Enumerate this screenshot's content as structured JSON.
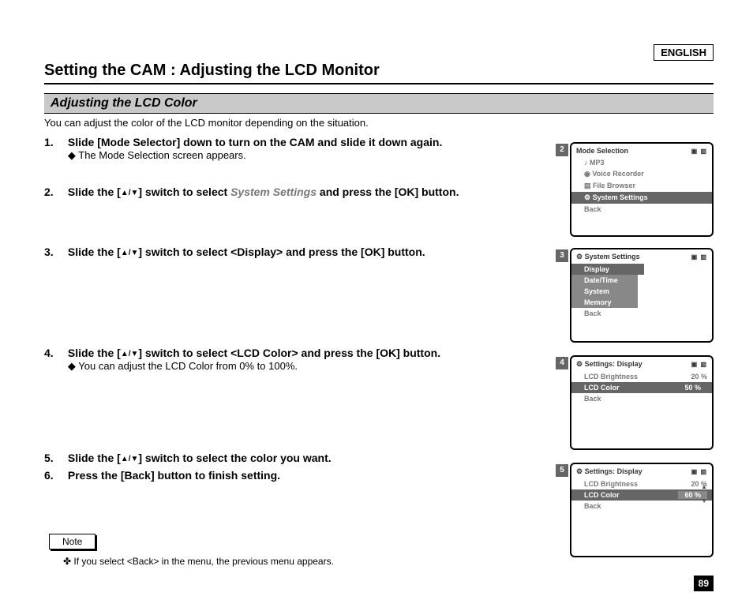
{
  "language": "ENGLISH",
  "page_title": "Setting the CAM : Adjusting the LCD Monitor",
  "section_title": "Adjusting the LCD Color",
  "intro": "You can adjust the color of the LCD monitor depending on the situation.",
  "steps": {
    "s1_num": "1.",
    "s1_text_a": "Slide [Mode Selector] down to turn on the CAM and slide it down again.",
    "s1_text_b": "◆ The Mode Selection screen appears.",
    "s2_num": "2.",
    "s2_text_a": "Slide the [",
    "s2_text_b": "] switch to select ",
    "s2_gray": "System Settings",
    "s2_text_c": " and press the [OK] button.",
    "s3_num": "3.",
    "s3_text_a": "Slide the [",
    "s3_text_b": "] switch to select <Display> and press the [OK] button.",
    "s4_num": "4.",
    "s4_text_a": "Slide the [",
    "s4_text_b": "] switch to select <LCD Color> and press the [OK] button.",
    "s4_text_c": "◆ You can adjust the LCD Color from 0% to 100%.",
    "s5_num": "5.",
    "s5_text": "Slide the [",
    "s5_text_b": "] switch to select the color you want.",
    "s6_num": "6.",
    "s6_text": "Press the [Back] button to finish setting."
  },
  "triangles": "▲/▼",
  "note_label": "Note",
  "note_text": "If you select <Back> in the menu, the previous menu appears.",
  "page_number": "89",
  "thumbs": {
    "t2": {
      "num": "2",
      "title": "Mode Selection",
      "items": [
        "MP3",
        "Voice Recorder",
        "File Browser"
      ],
      "selected": "System Settings",
      "back": "Back"
    },
    "t3": {
      "num": "3",
      "title": "System Settings",
      "selected": "Display",
      "items": [
        "Date/Time",
        "System",
        "Memory"
      ],
      "back": "Back"
    },
    "t4": {
      "num": "4",
      "title": "Settings: Display",
      "row1_label": "LCD Brightness",
      "row1_val": "20 %",
      "row2_label": "LCD Color",
      "row2_val": "50 %",
      "back": "Back"
    },
    "t5": {
      "num": "5",
      "title": "Settings: Display",
      "row1_label": "LCD Brightness",
      "row1_val": "20 %",
      "row2_label": "LCD Color",
      "row2_val": "60 %",
      "back": "Back"
    }
  }
}
